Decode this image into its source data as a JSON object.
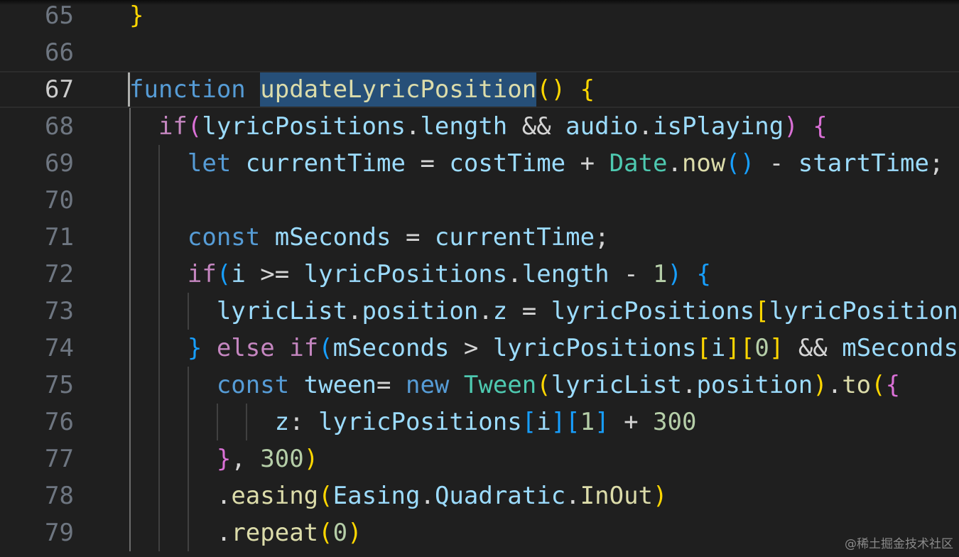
{
  "editor": {
    "colors": {
      "background": "#1f1f1f",
      "keyword": "#569cd6",
      "control": "#c586c0",
      "function": "#dcdcaa",
      "variable": "#9cdcfe",
      "type": "#4ec9b0",
      "number": "#b5cea8",
      "bracket_level1": "#ffd700",
      "bracket_level2": "#da70d6",
      "bracket_level3": "#179fff",
      "selection": "#264f78"
    },
    "current_line": "67",
    "selected_text": "updateLyricPosition",
    "lines": [
      {
        "number": "65",
        "tokens": [
          {
            "t": "}",
            "c": "b1"
          }
        ]
      },
      {
        "number": "66",
        "tokens": []
      },
      {
        "number": "67",
        "tokens": [
          {
            "t": "function",
            "c": "kw"
          },
          {
            "t": " ",
            "c": "pun"
          },
          {
            "t": "updateLyricPosition",
            "c": "fn"
          },
          {
            "t": "()",
            "c": "b1"
          },
          {
            "t": " ",
            "c": "pun"
          },
          {
            "t": "{",
            "c": "b1"
          }
        ]
      },
      {
        "number": "68",
        "tokens": [
          {
            "t": "  ",
            "c": "pun"
          },
          {
            "t": "if",
            "c": "ctl"
          },
          {
            "t": "(",
            "c": "b2"
          },
          {
            "t": "lyricPositions",
            "c": "var"
          },
          {
            "t": ".",
            "c": "pun"
          },
          {
            "t": "length",
            "c": "var"
          },
          {
            "t": " && ",
            "c": "pun"
          },
          {
            "t": "audio",
            "c": "var"
          },
          {
            "t": ".",
            "c": "pun"
          },
          {
            "t": "isPlaying",
            "c": "var"
          },
          {
            "t": ")",
            "c": "b2"
          },
          {
            "t": " ",
            "c": "pun"
          },
          {
            "t": "{",
            "c": "b2"
          }
        ]
      },
      {
        "number": "69",
        "tokens": [
          {
            "t": "    ",
            "c": "pun"
          },
          {
            "t": "let",
            "c": "kw"
          },
          {
            "t": " ",
            "c": "pun"
          },
          {
            "t": "currentTime",
            "c": "var"
          },
          {
            "t": " = ",
            "c": "pun"
          },
          {
            "t": "costTime",
            "c": "var"
          },
          {
            "t": " + ",
            "c": "pun"
          },
          {
            "t": "Date",
            "c": "typ"
          },
          {
            "t": ".",
            "c": "pun"
          },
          {
            "t": "now",
            "c": "fn"
          },
          {
            "t": "()",
            "c": "b3"
          },
          {
            "t": " - ",
            "c": "pun"
          },
          {
            "t": "startTime",
            "c": "var"
          },
          {
            "t": ";",
            "c": "pun"
          }
        ]
      },
      {
        "number": "70",
        "tokens": []
      },
      {
        "number": "71",
        "tokens": [
          {
            "t": "    ",
            "c": "pun"
          },
          {
            "t": "const",
            "c": "kw"
          },
          {
            "t": " ",
            "c": "pun"
          },
          {
            "t": "mSeconds",
            "c": "var"
          },
          {
            "t": " = ",
            "c": "pun"
          },
          {
            "t": "currentTime",
            "c": "var"
          },
          {
            "t": ";",
            "c": "pun"
          }
        ]
      },
      {
        "number": "72",
        "tokens": [
          {
            "t": "    ",
            "c": "pun"
          },
          {
            "t": "if",
            "c": "ctl"
          },
          {
            "t": "(",
            "c": "b3"
          },
          {
            "t": "i",
            "c": "var"
          },
          {
            "t": " >= ",
            "c": "pun"
          },
          {
            "t": "lyricPositions",
            "c": "var"
          },
          {
            "t": ".",
            "c": "pun"
          },
          {
            "t": "length",
            "c": "var"
          },
          {
            "t": " - ",
            "c": "pun"
          },
          {
            "t": "1",
            "c": "num"
          },
          {
            "t": ")",
            "c": "b3"
          },
          {
            "t": " ",
            "c": "pun"
          },
          {
            "t": "{",
            "c": "b3"
          }
        ]
      },
      {
        "number": "73",
        "tokens": [
          {
            "t": "      ",
            "c": "pun"
          },
          {
            "t": "lyricList",
            "c": "var"
          },
          {
            "t": ".",
            "c": "pun"
          },
          {
            "t": "position",
            "c": "var"
          },
          {
            "t": ".",
            "c": "pun"
          },
          {
            "t": "z",
            "c": "var"
          },
          {
            "t": " = ",
            "c": "pun"
          },
          {
            "t": "lyricPositions",
            "c": "var"
          },
          {
            "t": "[",
            "c": "b1"
          },
          {
            "t": "lyricPositions",
            "c": "var"
          }
        ]
      },
      {
        "number": "74",
        "tokens": [
          {
            "t": "    ",
            "c": "pun"
          },
          {
            "t": "}",
            "c": "b3"
          },
          {
            "t": " ",
            "c": "pun"
          },
          {
            "t": "else",
            "c": "ctl"
          },
          {
            "t": " ",
            "c": "pun"
          },
          {
            "t": "if",
            "c": "ctl"
          },
          {
            "t": "(",
            "c": "b3"
          },
          {
            "t": "mSeconds",
            "c": "var"
          },
          {
            "t": " > ",
            "c": "pun"
          },
          {
            "t": "lyricPositions",
            "c": "var"
          },
          {
            "t": "[",
            "c": "b1"
          },
          {
            "t": "i",
            "c": "var"
          },
          {
            "t": "]",
            "c": "b1"
          },
          {
            "t": "[",
            "c": "b1"
          },
          {
            "t": "0",
            "c": "num"
          },
          {
            "t": "]",
            "c": "b1"
          },
          {
            "t": " && ",
            "c": "pun"
          },
          {
            "t": "mSeconds",
            "c": "var"
          }
        ]
      },
      {
        "number": "75",
        "tokens": [
          {
            "t": "      ",
            "c": "pun"
          },
          {
            "t": "const",
            "c": "kw"
          },
          {
            "t": " ",
            "c": "pun"
          },
          {
            "t": "tween",
            "c": "var"
          },
          {
            "t": "= ",
            "c": "pun"
          },
          {
            "t": "new",
            "c": "kw"
          },
          {
            "t": " ",
            "c": "pun"
          },
          {
            "t": "Tween",
            "c": "typ"
          },
          {
            "t": "(",
            "c": "b1"
          },
          {
            "t": "lyricList",
            "c": "var"
          },
          {
            "t": ".",
            "c": "pun"
          },
          {
            "t": "position",
            "c": "var"
          },
          {
            "t": ")",
            "c": "b1"
          },
          {
            "t": ".",
            "c": "pun"
          },
          {
            "t": "to",
            "c": "fn"
          },
          {
            "t": "(",
            "c": "b1"
          },
          {
            "t": "{",
            "c": "b2"
          }
        ]
      },
      {
        "number": "76",
        "tokens": [
          {
            "t": "          ",
            "c": "pun"
          },
          {
            "t": "z",
            "c": "var"
          },
          {
            "t": ": ",
            "c": "pun"
          },
          {
            "t": "lyricPositions",
            "c": "var"
          },
          {
            "t": "[",
            "c": "b3"
          },
          {
            "t": "i",
            "c": "var"
          },
          {
            "t": "]",
            "c": "b3"
          },
          {
            "t": "[",
            "c": "b3"
          },
          {
            "t": "1",
            "c": "num"
          },
          {
            "t": "]",
            "c": "b3"
          },
          {
            "t": " + ",
            "c": "pun"
          },
          {
            "t": "300",
            "c": "num"
          }
        ]
      },
      {
        "number": "77",
        "tokens": [
          {
            "t": "      ",
            "c": "pun"
          },
          {
            "t": "}",
            "c": "b2"
          },
          {
            "t": ", ",
            "c": "pun"
          },
          {
            "t": "300",
            "c": "num"
          },
          {
            "t": ")",
            "c": "b1"
          }
        ]
      },
      {
        "number": "78",
        "tokens": [
          {
            "t": "      ",
            "c": "pun"
          },
          {
            "t": ".",
            "c": "pun"
          },
          {
            "t": "easing",
            "c": "fn"
          },
          {
            "t": "(",
            "c": "b1"
          },
          {
            "t": "Easing",
            "c": "var"
          },
          {
            "t": ".",
            "c": "pun"
          },
          {
            "t": "Quadratic",
            "c": "var"
          },
          {
            "t": ".",
            "c": "pun"
          },
          {
            "t": "InOut",
            "c": "fn"
          },
          {
            "t": ")",
            "c": "b1"
          }
        ]
      },
      {
        "number": "79",
        "tokens": [
          {
            "t": "      ",
            "c": "pun"
          },
          {
            "t": ".",
            "c": "pun"
          },
          {
            "t": "repeat",
            "c": "fn"
          },
          {
            "t": "(",
            "c": "b1"
          },
          {
            "t": "0",
            "c": "num"
          },
          {
            "t": ")",
            "c": "b1"
          }
        ]
      }
    ]
  },
  "watermark": {
    "text": "@稀土掘金技术社区"
  }
}
